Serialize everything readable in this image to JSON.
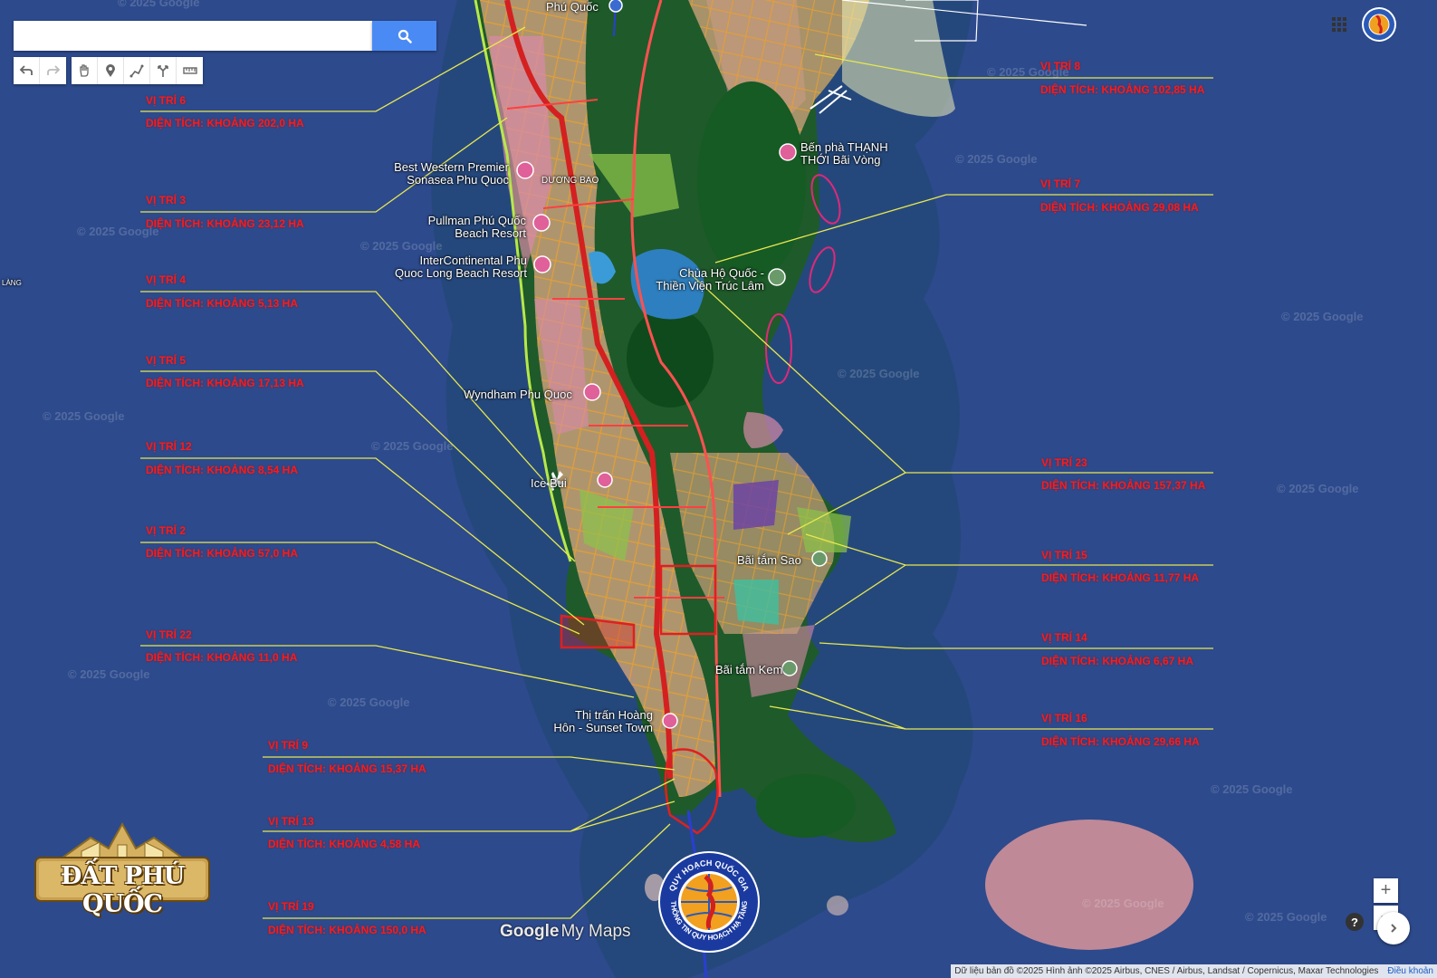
{
  "search": {
    "placeholder": ""
  },
  "toolbar": {
    "icons": [
      "undo-icon",
      "redo-icon",
      "hand-icon",
      "marker-icon",
      "draw-line-icon",
      "directions-icon",
      "ruler-icon"
    ]
  },
  "places": {
    "phu_quoc": "Phú Quốc",
    "ben_pha": [
      "Bến phà THẠNH",
      "THỚI Bãi Vòng"
    ],
    "best_western": [
      "Best Western Premier",
      "Sonasea Phu Quoc"
    ],
    "pullman": [
      "Pullman Phú Quốc",
      "Beach Resort"
    ],
    "intercontinental": [
      "InterContinental Phu",
      "Quoc Long Beach Resort"
    ],
    "thien_vien": [
      "Chùa Hộ Quốc -",
      "Thiền Viện Trúc Lâm"
    ],
    "wyndham": "Wyndham Phu Quoc",
    "ice": "Ice Bui",
    "bai_tam_sao": "Bãi tắm Sao",
    "bai_tam_kem": "Bãi tắm Kem",
    "thi_tran": [
      "Thị trấn Hoàng",
      "Hôn - Sunset Town"
    ],
    "duong_bao": "DƯƠNG BAO",
    "lang": "LÀNG"
  },
  "locations": [
    {
      "title": "VỊ TRÍ 6",
      "area": "DIỆN TÍCH: KHOẢNG 202,0 HA"
    },
    {
      "title": "VỊ TRÍ 3",
      "area": "DIỆN TÍCH: KHOẢNG 23,12 HA"
    },
    {
      "title": "VỊ TRÍ 4",
      "area": "DIỆN TÍCH: KHOẢNG 5,13 HA"
    },
    {
      "title": "VỊ TRÍ 5",
      "area": "DIỆN TÍCH: KHOẢNG 17,13 HA"
    },
    {
      "title": "VỊ TRÍ 12",
      "area": "DIỆN TÍCH: KHOẢNG 8,54 HA"
    },
    {
      "title": "VỊ TRÍ 2",
      "area": "DIỆN TÍCH: KHOẢNG 57,0 HA"
    },
    {
      "title": "VỊ TRÍ 22",
      "area": "DIỆN TÍCH: KHOẢNG 11,0 HA"
    },
    {
      "title": "VỊ TRÍ 9",
      "area": "DIỆN TÍCH: KHOẢNG 15,37 HA"
    },
    {
      "title": "VỊ TRÍ 13",
      "area": "DIỆN TÍCH: KHOẢNG 4,58 HA"
    },
    {
      "title": "VỊ TRÍ 19",
      "area": "DIỆN TÍCH: KHOẢNG 150,0 HA"
    },
    {
      "title": "VỊ TRÍ 8",
      "area": "DIỆN TÍCH: KHOẢNG 102,85 HA"
    },
    {
      "title": "VỊ TRÍ 7",
      "area": "DIỆN TÍCH: KHOẢNG 29,08 HA"
    },
    {
      "title": "VỊ TRÍ 23",
      "area": "DIỆN TÍCH: KHOẢNG 157,37 HA"
    },
    {
      "title": "VỊ TRÍ 15",
      "area": "DIỆN TÍCH: KHOẢNG 11,77 HA"
    },
    {
      "title": "VỊ TRÍ 14",
      "area": "DIỆN TÍCH: KHOẢNG 6,67 HA"
    },
    {
      "title": "VỊ TRÍ 16",
      "area": "DIỆN TÍCH: KHOẢNG 29,66 HA"
    }
  ],
  "watermark": "© 2025 Google",
  "brand": {
    "logo_text": "ĐẤT PHÚ QUỐC",
    "google": "Google",
    "my_maps": "My Maps",
    "seal_top": "QUY HOẠCH QUỐC GIA",
    "seal_bottom": "THÔNG TIN QUY HOẠCH HẠ TẦNG"
  },
  "zoom": {
    "plus": "+",
    "minus": "−",
    "help": "?"
  },
  "attribution": {
    "text": "Dữ liệu bản đồ ©2025 Hình ảnh ©2025 Airbus, CNES / Airbus, Landsat / Copernicus, Maxar Technologies",
    "terms": "Điều khoản"
  },
  "colors": {
    "sea": "#2d4a8c",
    "forest": "#1f5a2a",
    "urban": "#c9a07a",
    "label_red": "#ff1a1a",
    "leader_yellow": "#e8e850",
    "boundary_red": "#e02020",
    "search_blue": "#4a8af4"
  }
}
